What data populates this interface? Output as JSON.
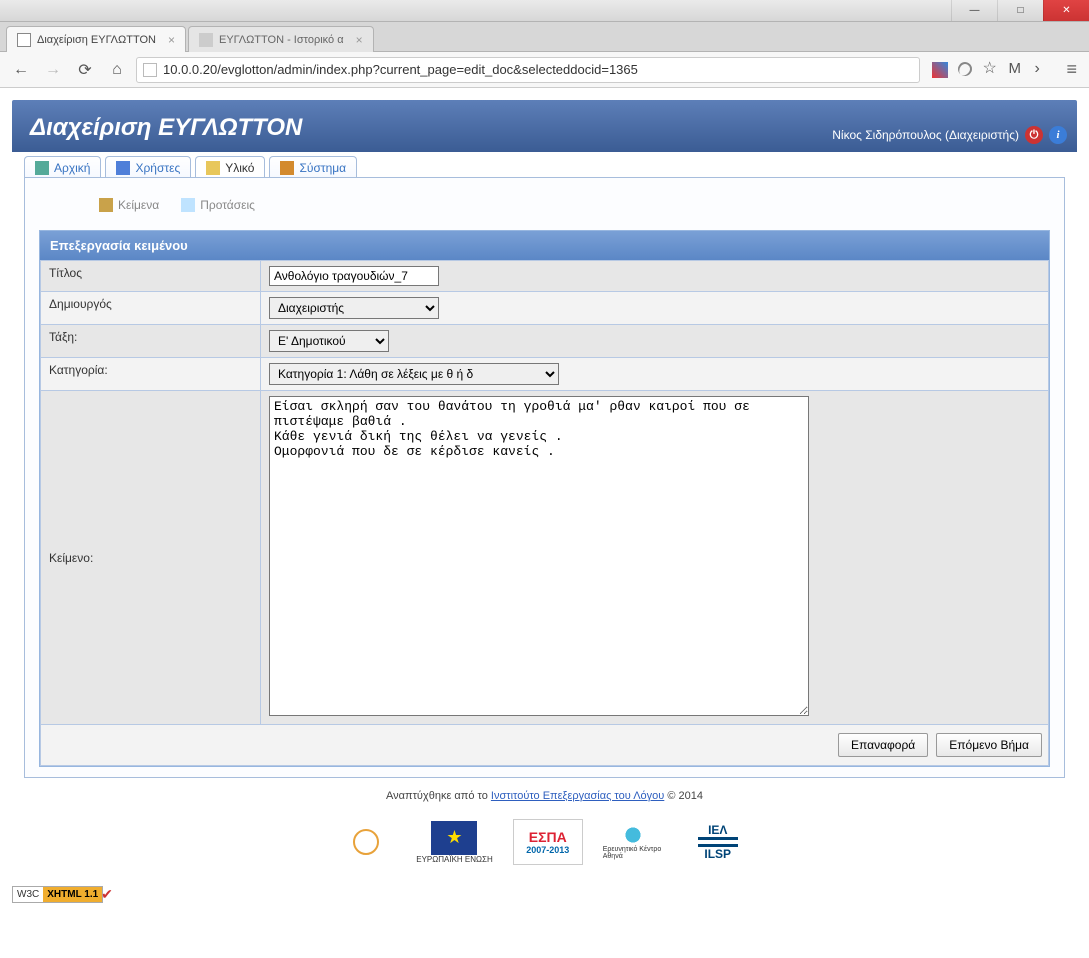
{
  "browser": {
    "tabs": [
      {
        "title": "Διαχείριση ΕΥΓΛΩΤΤΟΝ",
        "active": true
      },
      {
        "title": "ΕΥΓΛΩΤΤΟΝ - Ιστορικό α",
        "active": false
      }
    ],
    "url": "10.0.0.20/evglotton/admin/index.php?current_page=edit_doc&selecteddocid=1365"
  },
  "header": {
    "title": "Διαχείριση ΕΥΓΛΩΤΤΟΝ",
    "user": "Νίκος Σιδηρόπουλος (Διαχειριστής)"
  },
  "navtabs": {
    "home": "Αρχική",
    "users": "Χρήστες",
    "material": "Υλικό",
    "system": "Σύστημα"
  },
  "subnav": {
    "texts": "Κείμενα",
    "sentences": "Προτάσεις"
  },
  "form": {
    "box_title": "Επεξεργασία κειμένου",
    "labels": {
      "title": "Τίτλος",
      "creator": "Δημιουργός",
      "class": "Τάξη:",
      "category": "Κατηγορία:",
      "text": "Κείμενο:"
    },
    "values": {
      "title": "Ανθολόγιο τραγουδιών_7",
      "creator": "Διαχειριστής",
      "class": "Ε' Δημοτικού",
      "category": "Κατηγορία 1: Λάθη σε λέξεις με θ ή δ",
      "text": "Είσαι σκληρή σαν του θανάτου τη γροθιά μα' ρθαν καιροί που σε πιστέψαμε βαθιά .\nΚάθε γενιά δική της θέλει να γενείς .\nΟμορφονιά που δε σε κέρδισε κανείς ."
    },
    "buttons": {
      "reset": "Επαναφορά",
      "next": "Επόμενο Βήμα"
    }
  },
  "footer": {
    "pre": "Αναπτύχθηκε από το ",
    "link": "Ινστιτούτο Επεξεργασίας του Λόγου",
    "post": "© 2014"
  },
  "logos": {
    "eu_label": "ΕΥΡΩΠΑΪΚΗ ΕΝΩΣΗ",
    "espa": "ΕΣΠΑ",
    "espa_years": "2007-2013",
    "athena": "Ερευνητικό Κέντρο Αθηνά",
    "iel_top": "ΙΕΛ",
    "iel_bot": "ILSP"
  },
  "w3c": {
    "left": "W3C",
    "right": "XHTML 1.1"
  }
}
